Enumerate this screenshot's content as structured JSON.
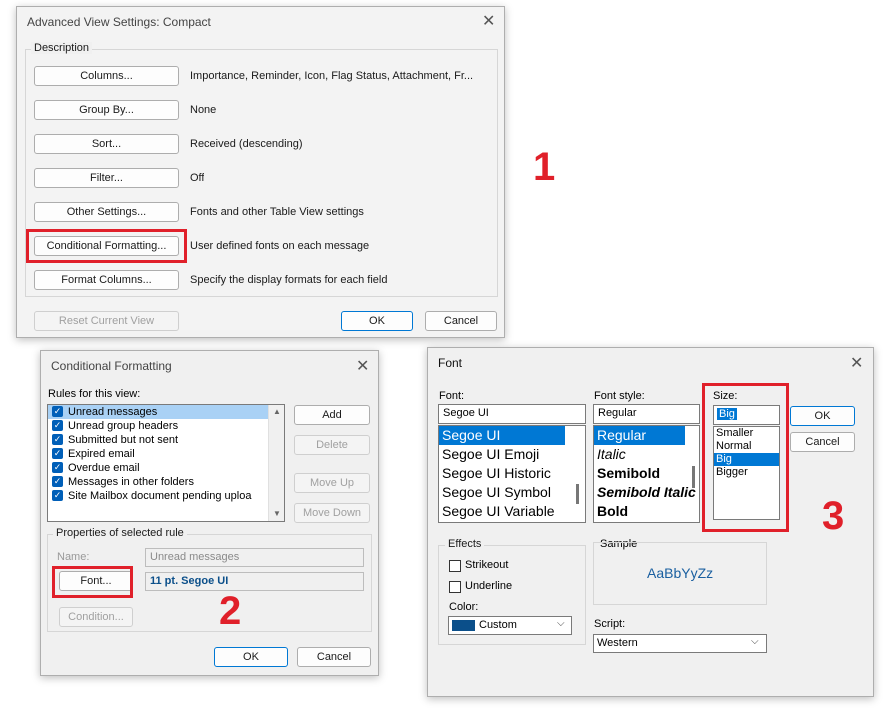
{
  "advanced": {
    "title": "Advanced View Settings: Compact",
    "description_label": "Description",
    "rows": [
      {
        "button": "Columns...",
        "value": "Importance, Reminder, Icon, Flag Status, Attachment, Fr..."
      },
      {
        "button": "Group By...",
        "value": "None"
      },
      {
        "button": "Sort...",
        "value": "Received (descending)"
      },
      {
        "button": "Filter...",
        "value": "Off"
      },
      {
        "button": "Other Settings...",
        "value": "Fonts and other Table View settings"
      },
      {
        "button": "Conditional Formatting...",
        "value": "User defined fonts on each message"
      },
      {
        "button": "Format Columns...",
        "value": "Specify the display formats for each field"
      }
    ],
    "reset_label": "Reset Current View",
    "ok_label": "OK",
    "cancel_label": "Cancel"
  },
  "conditional": {
    "title": "Conditional Formatting",
    "rules_label": "Rules for this view:",
    "rules": [
      "Unread messages",
      "Unread group headers",
      "Submitted but not sent",
      "Expired email",
      "Overdue email",
      "Messages in other folders",
      "Site Mailbox document pending uploa"
    ],
    "add_label": "Add",
    "delete_label": "Delete",
    "move_up_label": "Move Up",
    "move_down_label": "Move Down",
    "properties_label": "Properties of selected rule",
    "name_label": "Name:",
    "name_value": "Unread messages",
    "font_button": "Font...",
    "font_value": "11 pt. Segoe UI",
    "condition_button": "Condition...",
    "ok_label": "OK",
    "cancel_label": "Cancel"
  },
  "font": {
    "title": "Font",
    "font_label": "Font:",
    "font_value": "Segoe UI",
    "fonts": [
      "Segoe UI",
      "Segoe UI Emoji",
      "Segoe UI Historic",
      "Segoe UI Symbol",
      "Segoe UI Variable"
    ],
    "style_label": "Font style:",
    "style_value": "Regular",
    "styles": [
      "Regular",
      "Italic",
      "Semibold",
      "Semibold Italic",
      "Bold"
    ],
    "size_label": "Size:",
    "size_value": "Big",
    "sizes": [
      "Smaller",
      "Normal",
      "Big",
      "Bigger"
    ],
    "ok_label": "OK",
    "cancel_label": "Cancel",
    "effects_label": "Effects",
    "strikeout_label": "Strikeout",
    "underline_label": "Underline",
    "color_label": "Color:",
    "color_value": "Custom",
    "color_swatch": "#0b4f8a",
    "sample_label": "Sample",
    "sample_text": "AaBbYyZz",
    "script_label": "Script:",
    "script_value": "Western"
  },
  "annotations": {
    "one": "1",
    "two": "2",
    "three": "3"
  },
  "colors": {
    "highlight": "#e0202a",
    "accent": "#0078d4"
  }
}
